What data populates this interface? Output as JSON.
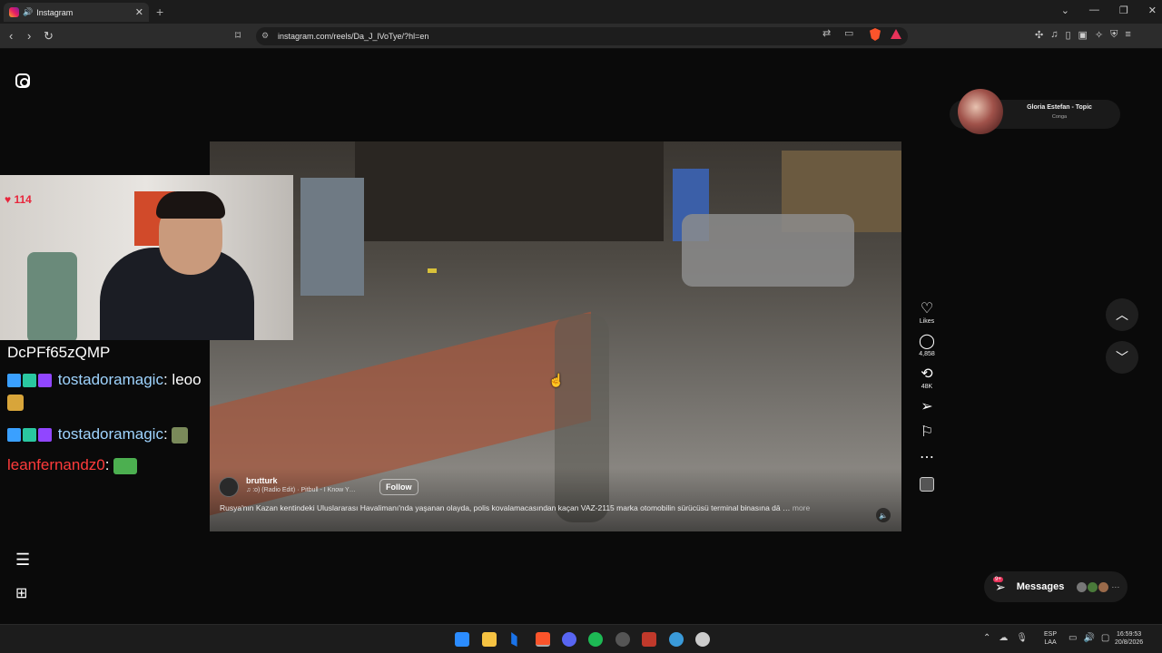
{
  "browser": {
    "tab_title": "Instagram",
    "new_tab_symbol": "+",
    "url": "instagram.com/reels/Da_J_lVoTye/?hl=en",
    "icons": [
      "back-icon",
      "forward-icon",
      "reload-icon",
      "bookmark-icon",
      "site-settings-icon",
      "translate-icon",
      "cast-icon",
      "brave-shields-icon",
      "brave-rewards-icon",
      "extensions-icon",
      "media-icon",
      "sidebar-icon",
      "wallet-icon",
      "leo-icon",
      "vpn-icon",
      "menu-icon"
    ]
  },
  "now_playing": {
    "title": "Gloria Estefan - Topic",
    "subtitle": "Conga"
  },
  "reel": {
    "author": "brutturk",
    "music": "♫ :o) (Radio Edit) · Pitbull - I Know Y…",
    "follow_label": "Follow",
    "caption": "Rusya'nın Kazan kentindeki Uluslararası Havalimanı'nda yaşanan olayda, polis kovalamacasından kaçan VAZ-2115 marka otomobilin sürücüsü terminal binasına dā …",
    "more_label": "more",
    "likes_label": "Likes",
    "comments_count": "4,858",
    "reposts_count": "48K"
  },
  "messages": {
    "label": "Messages",
    "badge": "9+"
  },
  "stream_overlay": {
    "heart_count": "114",
    "chat": [
      {
        "user": "DcPFf65zQMP",
        "text": "",
        "user_color": "#ffffff"
      },
      {
        "user": "tostadoramagic",
        "text": "leoo",
        "user_color": "#9fd4ff"
      },
      {
        "user": "tostadoramagic",
        "text": "",
        "user_color": "#9fd4ff"
      },
      {
        "user": "leanfernandz0",
        "text": "",
        "user_color": "#ff3b3b"
      }
    ]
  },
  "taskbar": {
    "lang_top": "ESP",
    "lang_bottom": "LAA",
    "time": "16:59:53",
    "date": "20/8/2026"
  }
}
